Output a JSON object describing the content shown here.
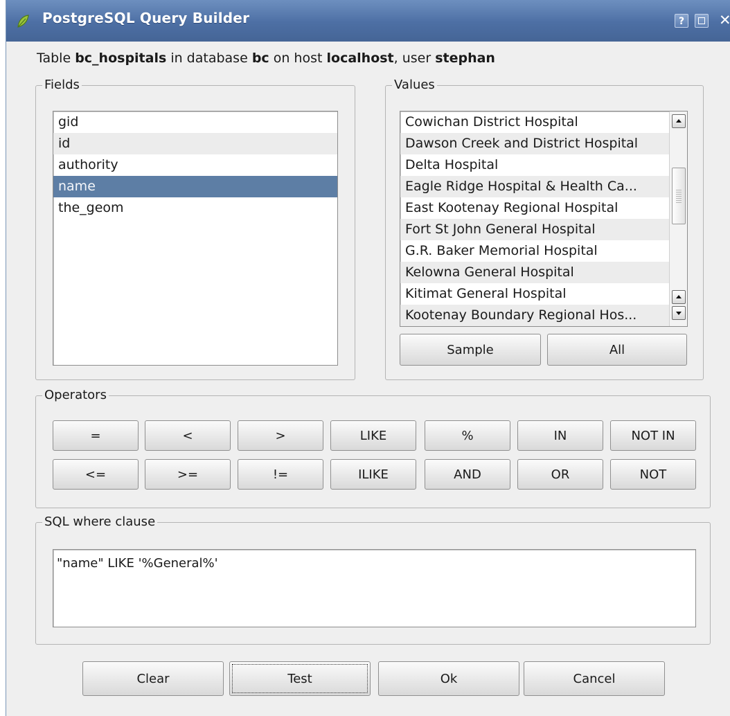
{
  "window": {
    "title": "PostgreSQL Query Builder",
    "help_label": "?",
    "close_label": "✕"
  },
  "headline": {
    "prefix": "Table ",
    "table": "bc_hospitals",
    "in_database": " in database ",
    "database": "bc",
    "on_host": " on host ",
    "host": "localhost",
    "user_label": ", user ",
    "user": "stephan"
  },
  "fields": {
    "group_label": "Fields",
    "items": [
      "gid",
      "id",
      "authority",
      "name",
      "the_geom"
    ],
    "selected": "name"
  },
  "values": {
    "group_label": "Values",
    "items": [
      "Cowichan District Hospital",
      "Dawson Creek and District Hospital",
      "Delta Hospital",
      "Eagle Ridge Hospital & Health Ca...",
      "East Kootenay Regional Hospital",
      "Fort St John General Hospital",
      "G.R. Baker Memorial Hospital",
      "Kelowna General Hospital",
      "Kitimat General Hospital",
      "Kootenay Boundary Regional Hos..."
    ],
    "sample_label": "Sample",
    "all_label": "All"
  },
  "operators": {
    "group_label": "Operators",
    "row1": [
      "=",
      "<",
      ">",
      "LIKE",
      "%",
      "IN",
      "NOT IN"
    ],
    "row2": [
      "<=",
      ">=",
      "!=",
      "ILIKE",
      "AND",
      "OR",
      "NOT"
    ]
  },
  "sql": {
    "group_label": "SQL where clause",
    "value": "\"name\" LIKE '%General%'"
  },
  "buttons": {
    "clear": "Clear",
    "test": "Test",
    "ok": "Ok",
    "cancel": "Cancel"
  }
}
